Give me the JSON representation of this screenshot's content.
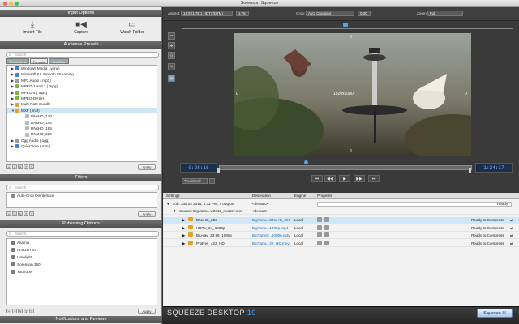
{
  "window": {
    "title": "Sorenson Squeeze"
  },
  "input_options": {
    "title": "Input Options",
    "buttons": [
      {
        "label": "Import File",
        "icon": "download-icon"
      },
      {
        "label": "Capture",
        "icon": "video-camera-icon"
      },
      {
        "label": "Watch Folder",
        "icon": "folder-icon"
      }
    ]
  },
  "presets": {
    "title": "Audience Presets",
    "search_placeholder": "Search",
    "tabs": [
      "Extensions",
      "Formats",
      "Workflow"
    ],
    "active_tab": 1,
    "rows": [
      {
        "label": "Windows Media (.wmv)",
        "color": "#4a80c8",
        "kind": "group"
      },
      {
        "label": "Microsoft IIS Smooth Streaming",
        "color": "#4a80c8",
        "kind": "group"
      },
      {
        "label": "MP3 Audio (.mp3)",
        "color": "#9a9a9a",
        "kind": "group"
      },
      {
        "label": "MPEG-1 and 2 (.mpg)",
        "color": "#7cb342",
        "kind": "group"
      },
      {
        "label": "MPEG-4 (.mp4)",
        "color": "#7cb342",
        "kind": "group"
      },
      {
        "label": "MPEG-DASH",
        "color": "#7cb342",
        "kind": "group"
      },
      {
        "label": "Multi-Rate Bundle",
        "color": "#e0a040",
        "kind": "group"
      },
      {
        "label": "MXF (.mxf)",
        "color": "#e8a020",
        "kind": "open"
      },
      {
        "label": "DNxHD_120",
        "color": "#bbbbbb",
        "kind": "sub"
      },
      {
        "label": "DNxHD_145",
        "color": "#bbbbbb",
        "kind": "sub"
      },
      {
        "label": "DNxHD_185",
        "color": "#bbbbbb",
        "kind": "sub"
      },
      {
        "label": "DNxHD_220",
        "color": "#bbbbbb",
        "kind": "sub"
      },
      {
        "label": "Ogg Audio (.ogg)",
        "color": "#9a9a9a",
        "kind": "group"
      },
      {
        "label": "QuickTime (.mov)",
        "color": "#4a80c8",
        "kind": "group"
      }
    ],
    "apply_label": "Apply"
  },
  "filters": {
    "title": "Filters",
    "search_placeholder": "Search",
    "items": [
      "Auto-Crop Deinterlace"
    ],
    "apply_label": "Apply"
  },
  "publishing": {
    "title": "Publishing Options",
    "search_placeholder": "Search",
    "items": [
      "Akamai",
      "Amazon S3",
      "Limelight",
      "Sorenson 360",
      "YouTube"
    ],
    "apply_label": "Apply"
  },
  "notifications": {
    "title": "Notifications and Reviews"
  },
  "top_controls": {
    "aspect_label": "Aspect:",
    "aspect_value": "16:9 (1.78:1 HDTV/DTM)",
    "aspect_ratio": "1.78",
    "crop_label": "Crop:",
    "crop_value": "Auto Cropping",
    "crop_num": "0.00",
    "zoom_label": "Zoom:",
    "zoom_value": "Full"
  },
  "video": {
    "resolution": "1920x1080",
    "edge_top": "0",
    "edge_left": "0",
    "edge_right": "0",
    "edge_bottom": "0"
  },
  "transport": {
    "timecode_in": "0:28:16",
    "timecode_out": "1:24:17",
    "thumbnail_label": "Thumbnail"
  },
  "jobs": {
    "headers": {
      "settings": "Settings",
      "destination": "Destination",
      "engine": "Engine",
      "progress": "Progress"
    },
    "job": {
      "label": "Job: Jan 24 2015, 3:12 PM, 4 outputs",
      "destination": "<default>",
      "status": "Ready"
    },
    "source": {
      "label": "Source: BigYarra...w0315_master.mov",
      "destination": "<default>"
    },
    "outputs": [
      {
        "name": "DNxHD_220",
        "destination": "BigYarra...DNxHD_220",
        "engine": "Local",
        "status": "Ready to Compress"
      },
      {
        "name": "HDTV_24_1080p",
        "destination": "BigYarra...1080p.mp4",
        "engine": "Local",
        "status": "Ready to Compress"
      },
      {
        "name": "Blu-ray_23.98_1080p",
        "destination": "BigYarraV...1080p.m2v",
        "engine": "Local",
        "status": "Ready to Compress"
      },
      {
        "name": "ProRes_422_HD",
        "destination": "BigYarra...22_HD.mov",
        "engine": "Local",
        "status": "Ready to Compress"
      }
    ]
  },
  "bottom": {
    "brand": "SQUEEZE DESKTOP",
    "version": "10",
    "squeeze_button": "Squeeze It!"
  },
  "colors": {
    "accent": "#4fa3e8",
    "selection": "#cfe6f7",
    "panel_header": "#5a5a5a"
  }
}
